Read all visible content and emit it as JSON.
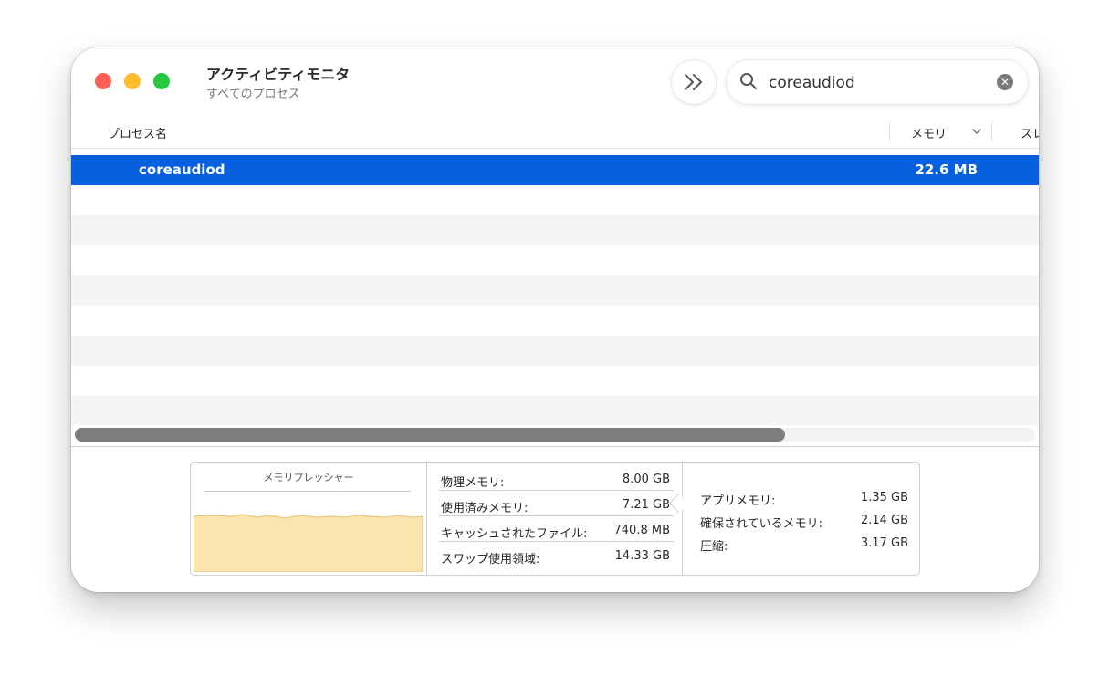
{
  "window": {
    "title": "アクティビティモニタ",
    "subtitle": "すべてのプロセス"
  },
  "toolbar": {
    "more_icon": "chevron-double-right-icon"
  },
  "search": {
    "value": "coreaudiod",
    "icon": "magnifier-icon",
    "clear_glyph": "✕"
  },
  "table": {
    "columns": {
      "name": "プロセス名",
      "memory": "メモリ",
      "next": "スレ"
    },
    "rows": [
      {
        "name": "coreaudiod",
        "memory": "22.6 MB",
        "selected": true
      }
    ],
    "scroll_fraction": 0.74
  },
  "memory_pressure": {
    "title": "メモリプレッシャー",
    "fill_color": "#fbe4ad",
    "stroke_color": "#e8c06a",
    "level": 0.6
  },
  "memory_stats": [
    {
      "label": "物理メモリ:",
      "value": "8.00 GB"
    },
    {
      "label": "使用済みメモリ:",
      "value": "7.21 GB"
    },
    {
      "label": "キャッシュされたファイル:",
      "value": "740.8 MB"
    },
    {
      "label": "スワップ使用領域:",
      "value": "14.33 GB"
    }
  ],
  "app_stats": [
    {
      "label": "アプリメモリ:",
      "value": "1.35 GB"
    },
    {
      "label": "確保されているメモリ:",
      "value": "2.14 GB"
    },
    {
      "label": "圧縮:",
      "value": "3.17 GB"
    }
  ],
  "colors": {
    "selection": "#0960de",
    "close": "#ff5f57",
    "minimize": "#febc2e",
    "maximize": "#28c840"
  }
}
